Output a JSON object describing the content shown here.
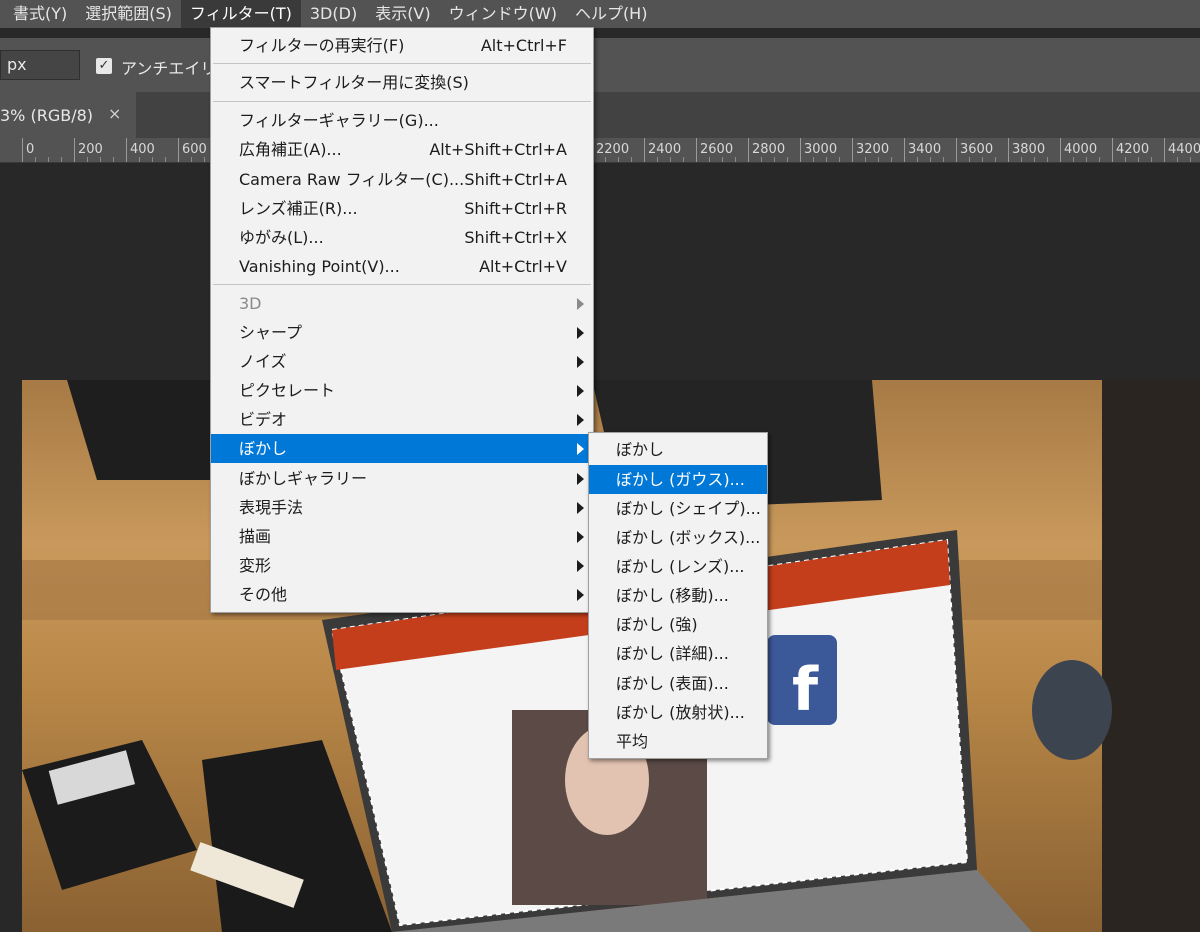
{
  "menubar": {
    "items": [
      {
        "label": "書式(Y)"
      },
      {
        "label": "選択範囲(S)"
      },
      {
        "label": "フィルター(T)"
      },
      {
        "label": "3D(D)"
      },
      {
        "label": "表示(V)"
      },
      {
        "label": "ウィンドウ(W)"
      },
      {
        "label": "ヘルプ(H)"
      }
    ],
    "active_index": 2
  },
  "options_bar": {
    "unit_value": "px",
    "antialias_label": "アンチエイリア",
    "antialias_checked": true
  },
  "document_tab": {
    "title": "3% (RGB/8)",
    "close_glyph": "×"
  },
  "ruler": {
    "labels": [
      "0",
      "200",
      "400",
      "600",
      "2200",
      "2400",
      "2600",
      "2800",
      "3000",
      "3200",
      "3400",
      "3600",
      "3800",
      "4000",
      "4200",
      "4400"
    ]
  },
  "filter_menu": {
    "items": [
      {
        "label": "フィルターの再実行(F)",
        "shortcut": "Alt+Ctrl+F",
        "disabled": true
      },
      {
        "label": "スマートフィルター用に変換(S)",
        "shortcut": ""
      },
      {
        "label": "フィルターギャラリー(G)...",
        "shortcut": ""
      },
      {
        "label": "広角補正(A)...",
        "shortcut": "Alt+Shift+Ctrl+A"
      },
      {
        "label": "Camera Raw フィルター(C)...",
        "shortcut": "Shift+Ctrl+A"
      },
      {
        "label": "レンズ補正(R)...",
        "shortcut": "Shift+Ctrl+R"
      },
      {
        "label": "ゆがみ(L)...",
        "shortcut": "Shift+Ctrl+X"
      },
      {
        "label": "Vanishing Point(V)...",
        "shortcut": "Alt+Ctrl+V"
      },
      {
        "label": "3D",
        "submenu": true,
        "disabled": true
      },
      {
        "label": "シャープ",
        "submenu": true
      },
      {
        "label": "ノイズ",
        "submenu": true
      },
      {
        "label": "ピクセレート",
        "submenu": true
      },
      {
        "label": "ビデオ",
        "submenu": true
      },
      {
        "label": "ぼかし",
        "submenu": true,
        "highlighted": true
      },
      {
        "label": "ぼかしギャラリー",
        "submenu": true
      },
      {
        "label": "表現手法",
        "submenu": true
      },
      {
        "label": "描画",
        "submenu": true
      },
      {
        "label": "変形",
        "submenu": true
      },
      {
        "label": "その他",
        "submenu": true
      }
    ]
  },
  "blur_submenu": {
    "items": [
      {
        "label": "ぼかし"
      },
      {
        "label": "ぼかし (ガウス)...",
        "highlighted": true
      },
      {
        "label": "ぼかし (シェイプ)..."
      },
      {
        "label": "ぼかし (ボックス)..."
      },
      {
        "label": "ぼかし (レンズ)..."
      },
      {
        "label": "ぼかし (移動)..."
      },
      {
        "label": "ぼかし (強)"
      },
      {
        "label": "ぼかし (詳細)..."
      },
      {
        "label": "ぼかし (表面)..."
      },
      {
        "label": "ぼかし (放射状)..."
      },
      {
        "label": "平均"
      }
    ]
  },
  "colors": {
    "menu_highlight": "#0078d7",
    "chrome": "#535353",
    "workspace": "#282828"
  }
}
